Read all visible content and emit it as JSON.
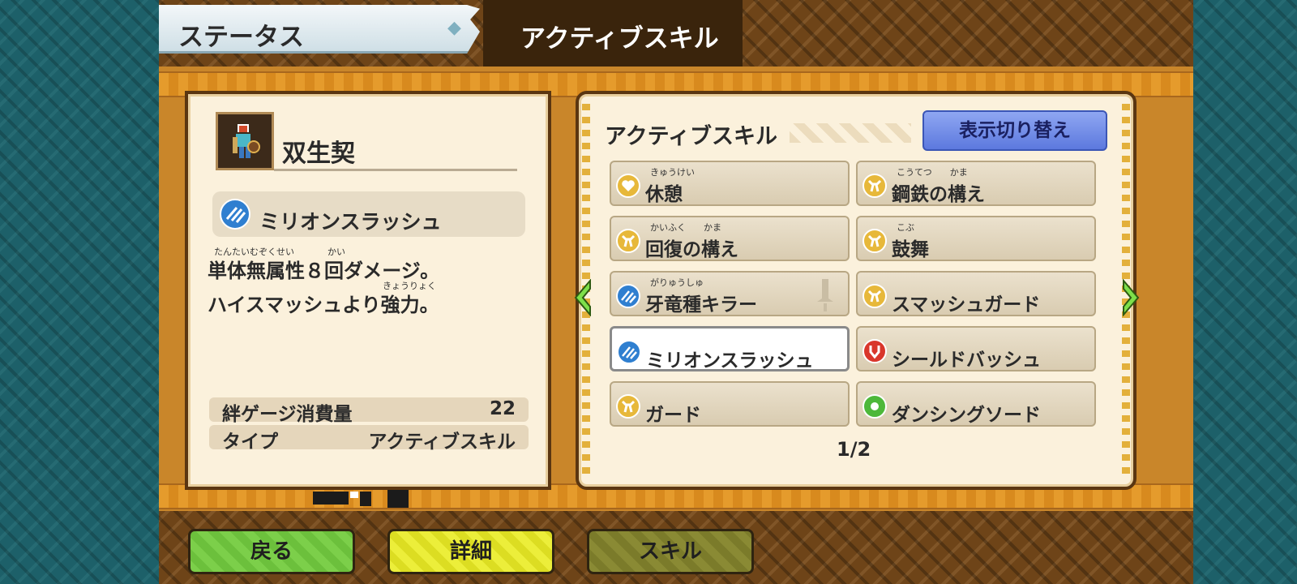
{
  "tabs": {
    "status": "ステータス",
    "active_skill": "アクティブスキル"
  },
  "character": {
    "name": "双生契",
    "portrait_icon": "character-portrait-icon"
  },
  "selected_skill": {
    "name": "ミリオンスラッシュ",
    "icon": "slash-skill-icon",
    "icon_color": "#2f7fd0",
    "description_line1": "単体無属性８回ダメージ。",
    "description_line2": "ハイスマッシュより強力。",
    "ruby_line1_a": "たんたいむぞくせい",
    "ruby_line1_b": "かい",
    "ruby_line2": "きょうりょく"
  },
  "stats": {
    "gauge_label": "絆ゲージ消費量",
    "gauge_value": "22",
    "type_label": "タイプ",
    "type_value": "アクティブスキル"
  },
  "skill_panel": {
    "title": "アクティブスキル",
    "toggle_label": "表示切り替え",
    "page": "1/2",
    "skills": [
      {
        "label": "休憩",
        "ruby": "きゅうけい",
        "icon": "heart-icon",
        "color": "#e7b83a"
      },
      {
        "label": "鋼鉄の構え",
        "ruby": "こうてつ　　かま",
        "icon": "power-icon",
        "color": "#e7b83a"
      },
      {
        "label": "回復の構え",
        "ruby": "かいふく　　かま",
        "icon": "power-icon",
        "color": "#e7b83a"
      },
      {
        "label": "鼓舞",
        "ruby": "こぶ",
        "icon": "power-icon",
        "color": "#e7b83a"
      },
      {
        "label": "牙竜種キラー",
        "ruby": "がりゅうしゅ",
        "icon": "slash-skill-icon",
        "color": "#2f7fd0"
      },
      {
        "label": "スマッシュガード",
        "ruby": "",
        "icon": "power-icon",
        "color": "#e7b83a"
      },
      {
        "label": "ミリオンスラッシュ",
        "ruby": "",
        "icon": "slash-skill-icon",
        "color": "#2f7fd0"
      },
      {
        "label": "シールドバッシュ",
        "ruby": "",
        "icon": "fist-icon",
        "color": "#d9362b"
      },
      {
        "label": "ガード",
        "ruby": "",
        "icon": "power-icon",
        "color": "#e7b83a"
      },
      {
        "label": "ダンシングソード",
        "ruby": "",
        "icon": "spark-icon",
        "color": "#4db83a"
      }
    ]
  },
  "nav": {
    "back": "戻る",
    "detail": "詳細",
    "skill": "スキル"
  }
}
